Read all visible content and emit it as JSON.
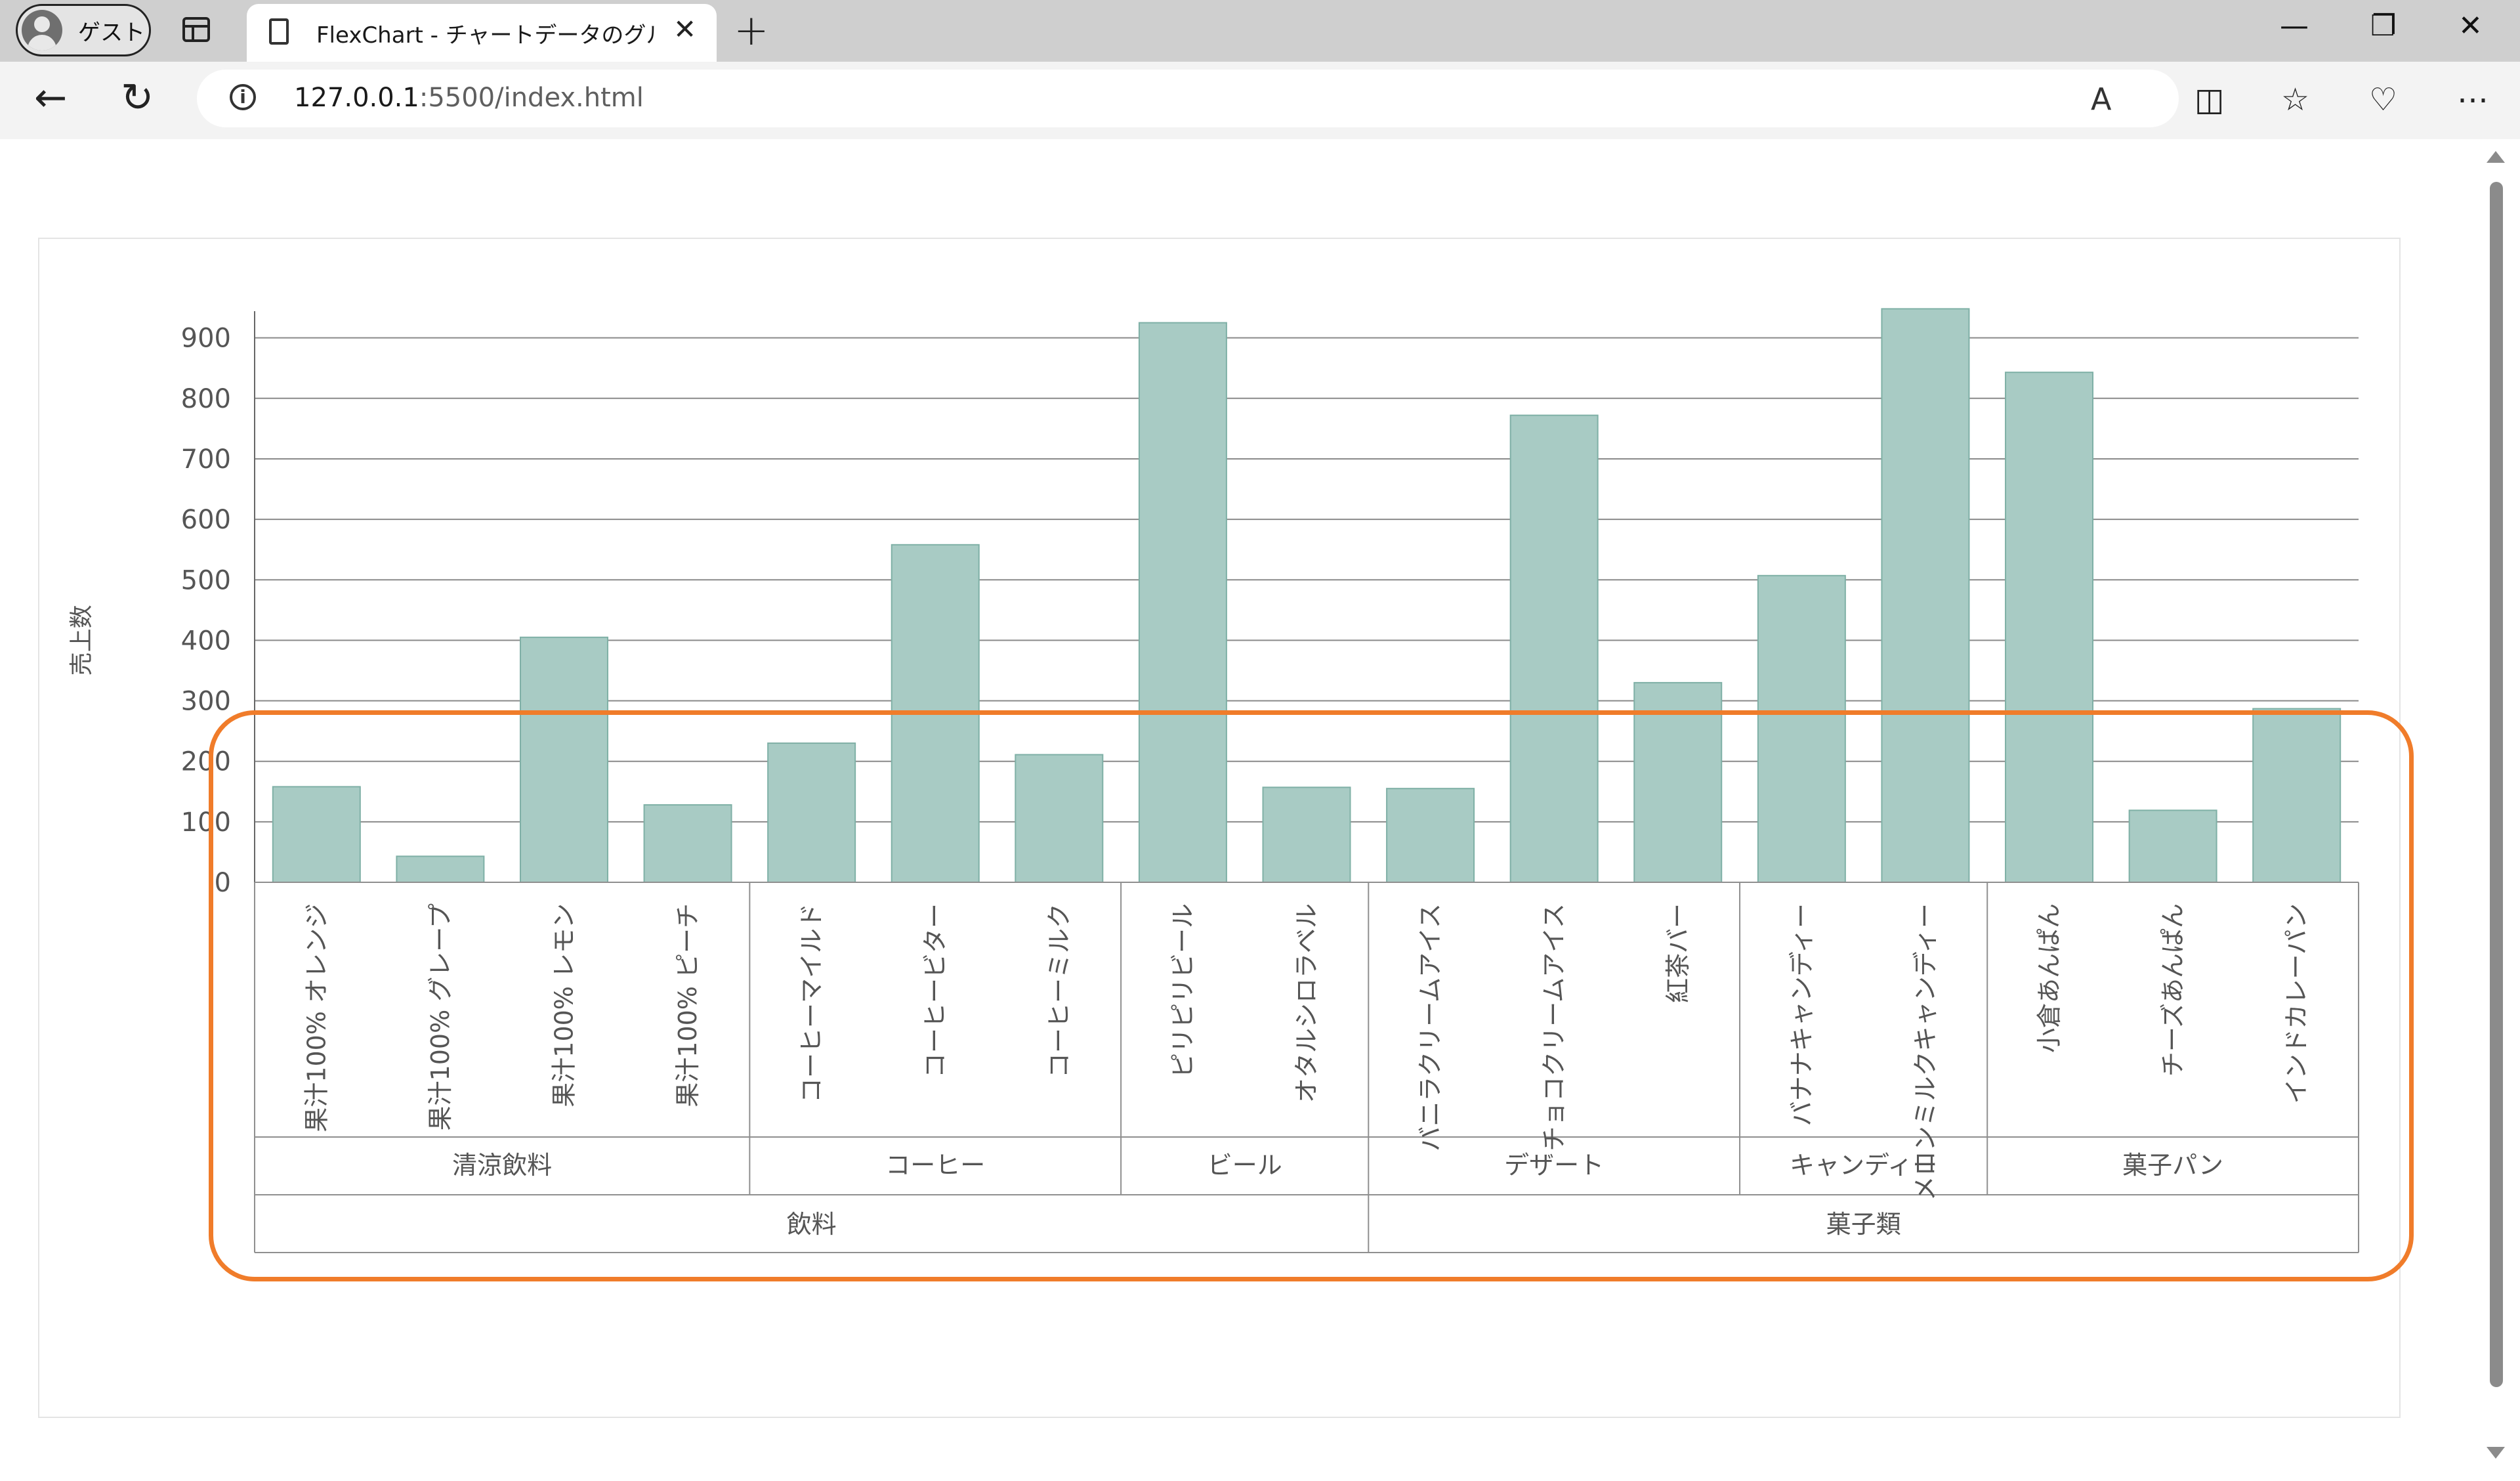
{
  "browser": {
    "profile_label": "ゲスト",
    "tab_title": "FlexChart - チャートデータのグループ化",
    "tab_close": "✕",
    "new_tab": "+",
    "url_host": "127.0.0.1",
    "url_rest": ":5500/index.html",
    "window_controls": {
      "minimize": "—",
      "restore": "❐",
      "close": "✕"
    }
  },
  "chart_data": {
    "type": "bar",
    "ylabel": "売上数",
    "xlabel": "",
    "ylim": [
      0,
      950
    ],
    "yticks": [
      0,
      100,
      200,
      300,
      400,
      500,
      600,
      700,
      800,
      900
    ],
    "grid": true,
    "bar_color": "#a8cbc4",
    "bar_stroke": "#7fb0a6",
    "categories": [
      "果汁100% オレンジ",
      "果汁100% グレープ",
      "果汁100% レモン",
      "果汁100% ピーチ",
      "コーヒーマイルド",
      "コーヒービター",
      "コーヒーミルク",
      "ピリピリビール",
      "オタルシロラベル",
      "バニラクリームアイス",
      "チョコクリームアイス",
      "紅茶バー",
      "バナナキャンディー",
      "メロンミルクキャンディー",
      "小倉あんぱん",
      "チーズあんぱん",
      "インドカレーパン"
    ],
    "values": [
      158,
      43,
      405,
      128,
      230,
      558,
      211,
      925,
      157,
      155,
      772,
      330,
      507,
      948,
      843,
      119,
      287
    ],
    "groups_level1": [
      {
        "label": "清涼飲料",
        "start": 0,
        "count": 4
      },
      {
        "label": "コーヒー",
        "start": 4,
        "count": 3
      },
      {
        "label": "ビール",
        "start": 7,
        "count": 2
      },
      {
        "label": "デザート",
        "start": 9,
        "count": 3
      },
      {
        "label": "キャンディー",
        "start": 12,
        "count": 2
      },
      {
        "label": "菓子パン",
        "start": 14,
        "count": 3
      }
    ],
    "groups_level2": [
      {
        "label": "飲料",
        "start": 0,
        "count": 9
      },
      {
        "label": "菓子類",
        "start": 9,
        "count": 8
      }
    ]
  },
  "highlight_color": "#f07c2a"
}
